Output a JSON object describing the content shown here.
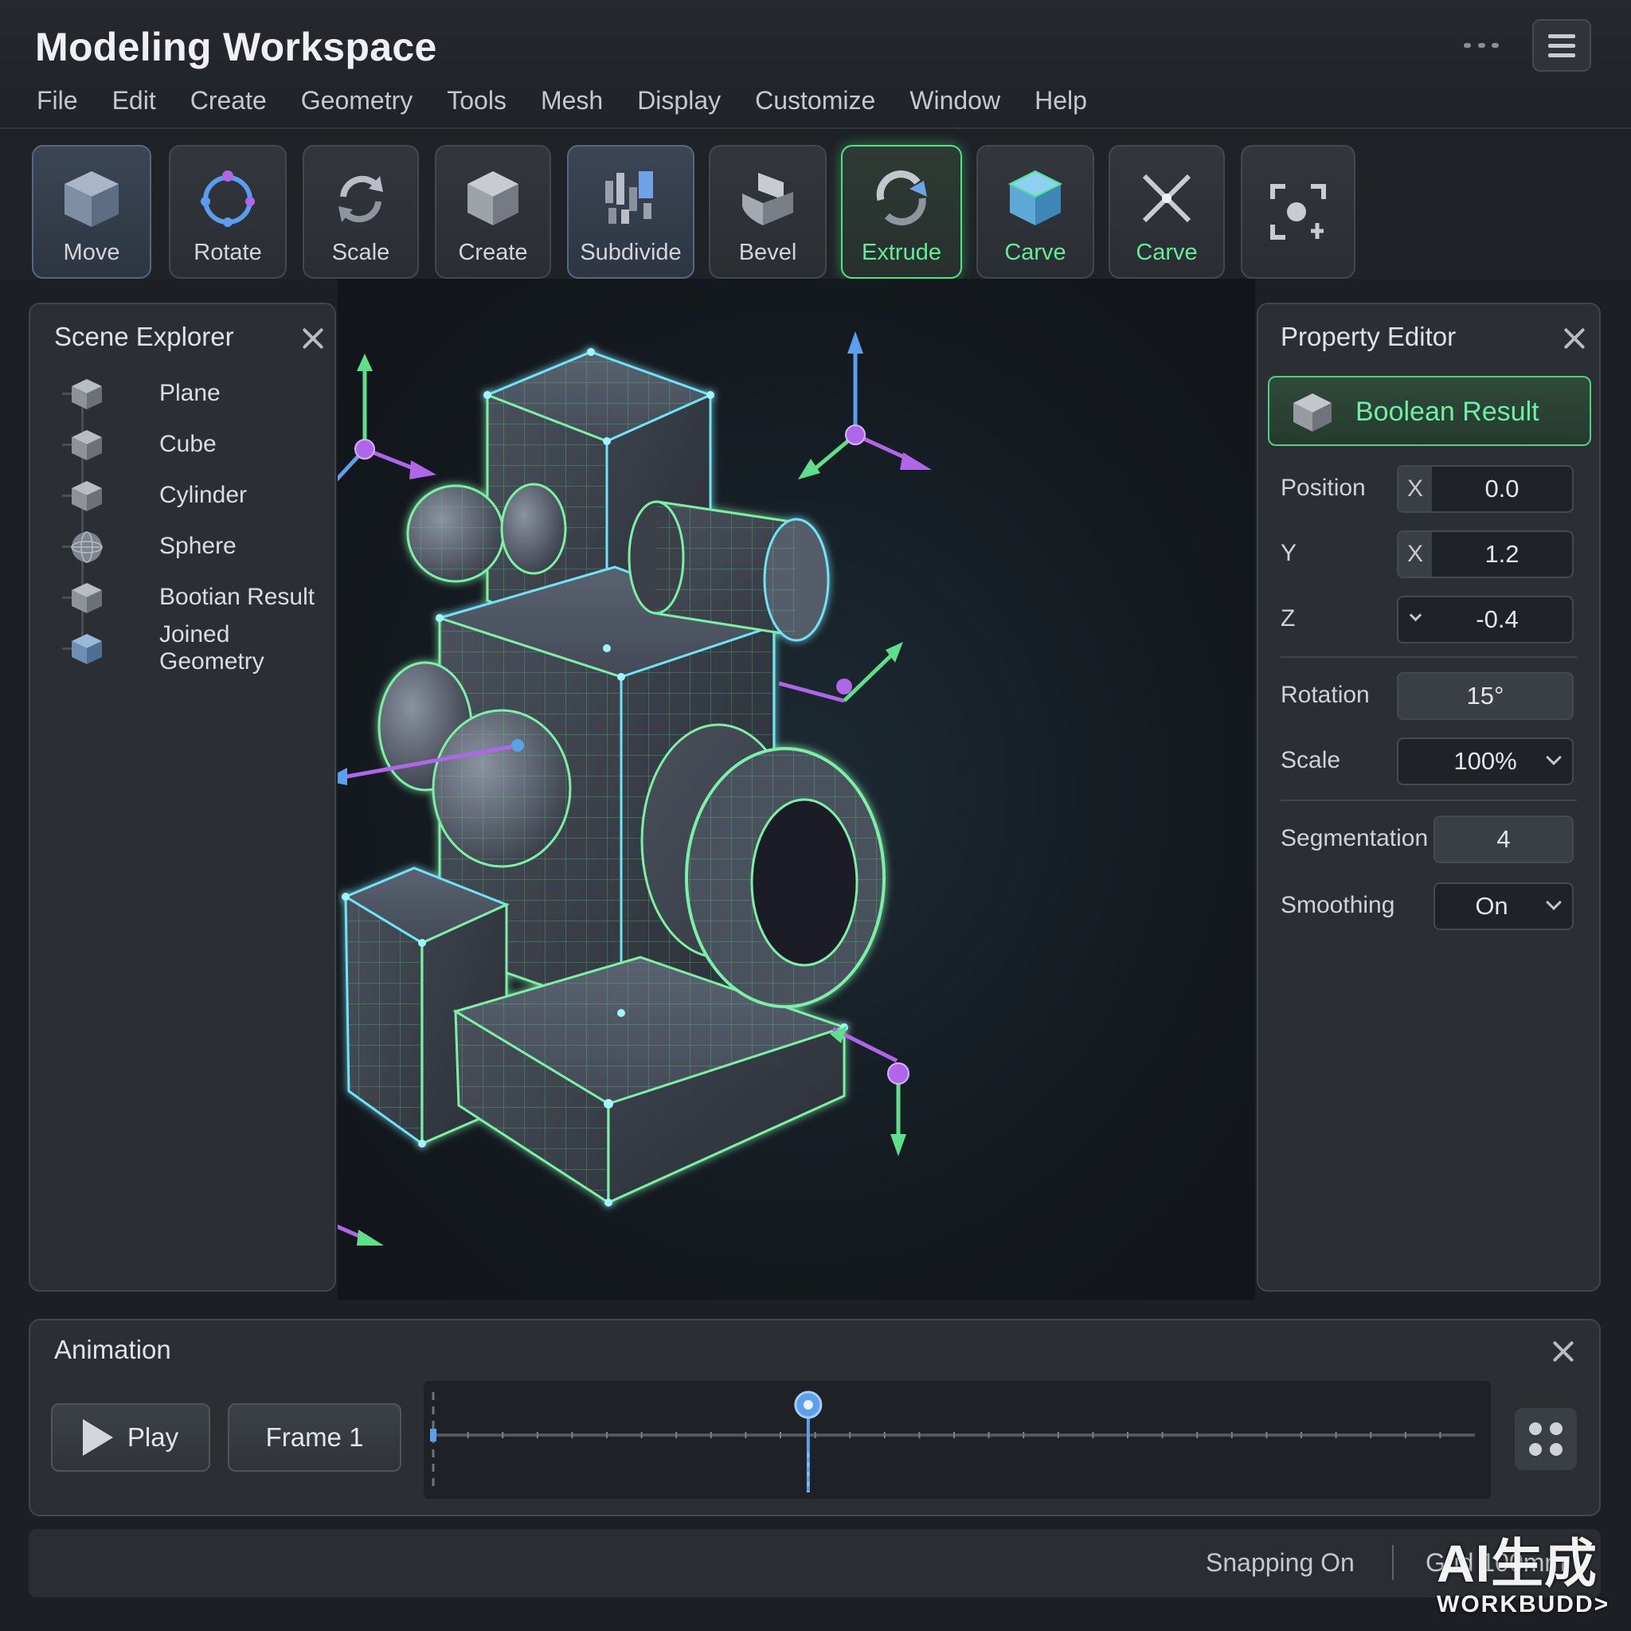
{
  "window": {
    "title": "Modeling Workspace",
    "menu": [
      "File",
      "Edit",
      "Create",
      "Geometry",
      "Tools",
      "Mesh",
      "Display",
      "Customize",
      "Window",
      "Help"
    ]
  },
  "toolbar": {
    "buttons": [
      {
        "label": "Move",
        "icon": "cube-icon",
        "state": "active"
      },
      {
        "label": "Rotate",
        "icon": "rotate-icon",
        "state": "normal"
      },
      {
        "label": "Scale",
        "icon": "scale-icon",
        "state": "normal"
      },
      {
        "label": "Create",
        "icon": "cube-icon",
        "state": "normal"
      },
      {
        "label": "Subdivide",
        "icon": "subdivide-icon",
        "state": "active"
      },
      {
        "label": "Bevel",
        "icon": "bevel-icon",
        "state": "normal"
      },
      {
        "label": "Extrude",
        "icon": "extrude-icon",
        "state": "highlighted"
      },
      {
        "label": "Carve",
        "icon": "cube-icon",
        "state": "green-text"
      },
      {
        "label": "Carve",
        "icon": "carve-icon",
        "state": "green-text"
      },
      {
        "label": "",
        "icon": "focus-icon",
        "state": "normal"
      }
    ]
  },
  "scene_explorer": {
    "title": "Scene Explorer",
    "items": [
      {
        "label": "Plane",
        "icon": "cube-icon"
      },
      {
        "label": "Cube",
        "icon": "cube-icon"
      },
      {
        "label": "Cylinder",
        "icon": "cube-icon"
      },
      {
        "label": "Sphere",
        "icon": "sphere-icon"
      },
      {
        "label": "Bootian Result",
        "icon": "cube-icon"
      },
      {
        "label": "Joined Geometry",
        "icon": "blue-cube-icon"
      }
    ]
  },
  "property_editor": {
    "title": "Property Editor",
    "selected": "Boolean Result",
    "position_label": "Position",
    "position_x_axis": "X",
    "position_x": "0.0",
    "y_label": "Y",
    "y_axis": "X",
    "y_value": "1.2",
    "z_label": "Z",
    "z_value": "-0.4",
    "rotation_label": "Rotation",
    "rotation_value": "15°",
    "scale_label": "Scale",
    "scale_value": "100%",
    "segmentation_label": "Segmentation",
    "segmentation_value": "4",
    "smoothing_label": "Smoothing",
    "smoothing_value": "On"
  },
  "animation": {
    "title": "Animation",
    "play_label": "Play",
    "frame_label": "Frame 1",
    "playhead_position": 0.36
  },
  "status": {
    "snapping": "Snapping On",
    "grid": "Grid 100mm"
  },
  "watermark": {
    "top": "AI生成",
    "bottom": "WORKBUDD>"
  },
  "colors": {
    "accent_green": "#4ee38a",
    "accent_blue": "#5aa0ea",
    "wire_cyan": "#6fe3f5",
    "gizmo_purple": "#b066e8"
  }
}
